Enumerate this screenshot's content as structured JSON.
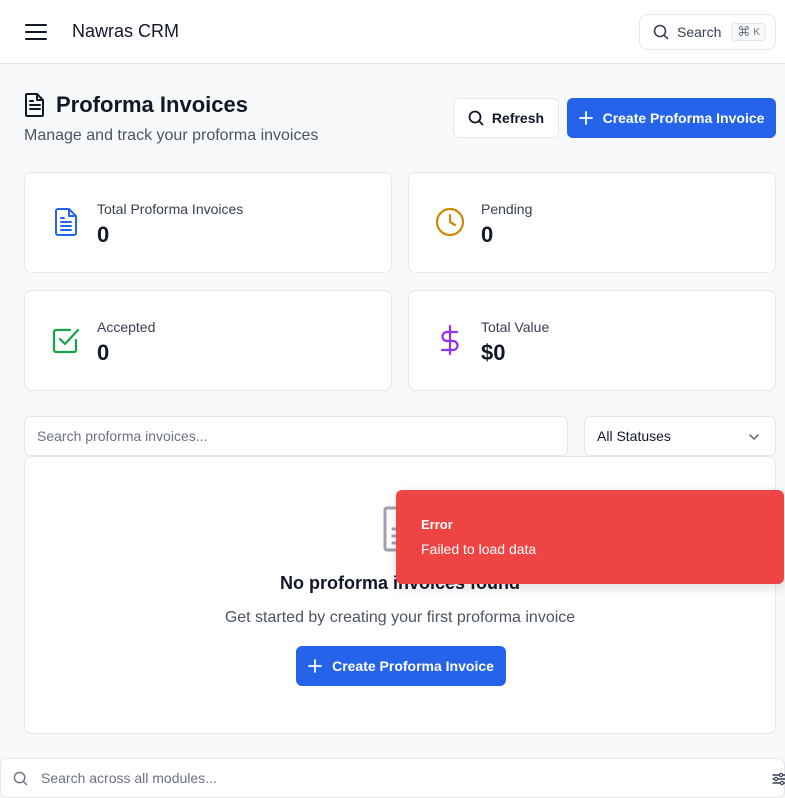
{
  "app": {
    "brand": "Nawras CRM"
  },
  "header": {
    "search_label": "Search",
    "shortcut_symbol": "⌘",
    "shortcut_key": "K"
  },
  "page": {
    "title": "Proforma Invoices",
    "subtitle": "Manage and track your proforma invoices",
    "refresh_label": "Refresh",
    "create_label": "Create Proforma Invoice"
  },
  "stats": [
    {
      "label": "Total Proforma Invoices",
      "value": "0",
      "icon": "document-icon",
      "color": "#2563eb"
    },
    {
      "label": "Pending",
      "value": "0",
      "icon": "clock-icon",
      "color": "#ca8a04"
    },
    {
      "label": "Accepted",
      "value": "0",
      "icon": "check-square-icon",
      "color": "#16a34a"
    },
    {
      "label": "Total Value",
      "value": "$0",
      "icon": "dollar-icon",
      "color": "#9333ea"
    }
  ],
  "filters": {
    "search_placeholder": "Search proforma invoices...",
    "status_selected": "All Statuses"
  },
  "empty_state": {
    "title": "No proforma invoices found",
    "subtitle": "Get started by creating your first proforma invoice",
    "button_label": "Create Proforma Invoice"
  },
  "toast": {
    "title": "Error",
    "message": "Failed to load data",
    "color": "#ef4444"
  },
  "global_search": {
    "placeholder": "Search across all modules..."
  },
  "colors": {
    "primary": "#2563eb",
    "border": "#e5e7eb",
    "background": "#f8f9fb"
  }
}
